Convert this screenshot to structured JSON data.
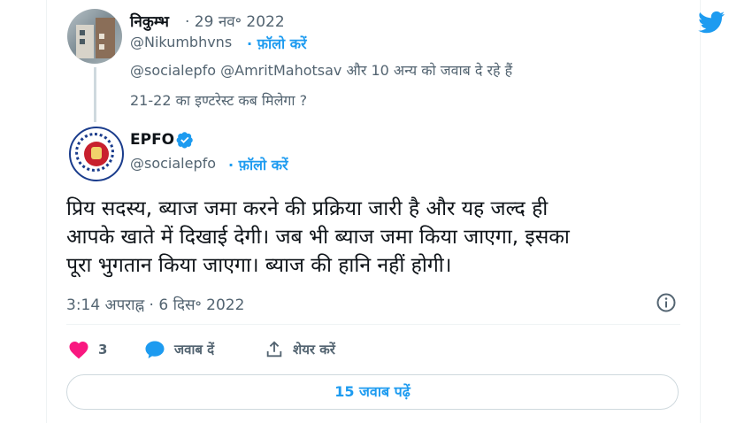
{
  "reply_tweet": {
    "author_name": "निकुम्भ",
    "date": "· 29 नव॰ 2022",
    "handle": "@Nikumbhvns",
    "follow_label": "· फ़ॉलो करें",
    "replying_to": "@socialepfo @AmritMahotsav और 10 अन्य को जवाब दे रहे हैं",
    "text": "21-22 का इण्टरेस्ट कब मिलेगा ?"
  },
  "main_tweet": {
    "author_name": "EPFO",
    "handle": "@socialepfo",
    "follow_label": "· फ़ॉलो करें",
    "text_lines": [
      "प्रिय सदस्य, ब्याज जमा करने की प्रक्रिया जारी है और यह जल्द ही",
      "आपके खाते में दिखाई देगी। जब भी ब्याज जमा किया जाएगा, इसका",
      "पूरा भुगतान किया जाएगा। ब्याज की हानि नहीं होगी।"
    ],
    "timestamp": "3:14 अपराह्न · 6 दिस॰ 2022"
  },
  "actions": {
    "likes": "3",
    "reply_label": "जवाब दें",
    "share_label": "शेयर करें"
  },
  "more_replies_label": "15 जवाब पढ़ें",
  "colors": {
    "accent": "#1d9bf0",
    "like": "#f91880",
    "secondary_text": "#536471"
  },
  "icons": [
    "twitter-bird-icon",
    "verified-badge-icon",
    "info-icon",
    "heart-icon",
    "reply-bubble-icon",
    "share-icon"
  ]
}
